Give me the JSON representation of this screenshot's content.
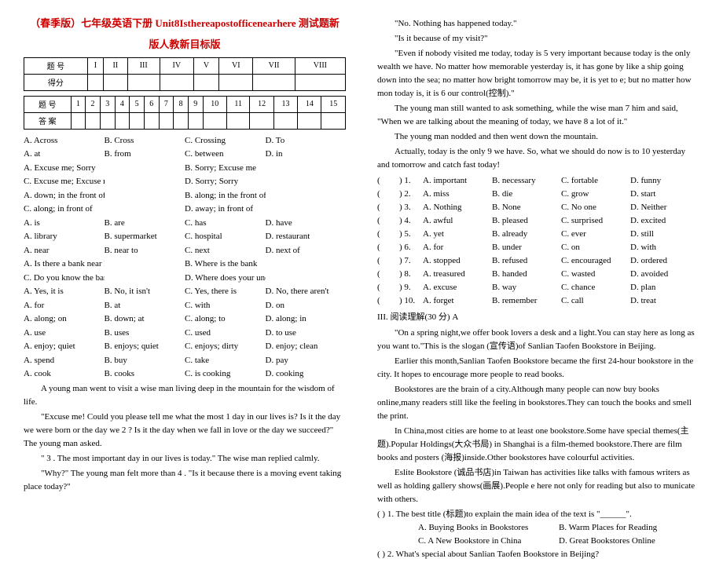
{
  "title_line1": "（春季版）七年级英语下册 Unit8Isthereapostofficenearhere 测试题新",
  "title_line2": "版人教新目标版",
  "table1": {
    "r1": [
      "题 号",
      "I",
      "II",
      "III",
      "IV",
      "V",
      "VI",
      "VII",
      "VIII"
    ],
    "r2": "得分"
  },
  "table2": {
    "r1": [
      "题 号",
      "1",
      "2",
      "3",
      "4",
      "5",
      "6",
      "7",
      "8",
      "9",
      "10",
      "11",
      "12",
      "13",
      "14",
      "15"
    ],
    "r2": "答 案"
  },
  "mc": [
    {
      "a": "A. Across",
      "b": "B. Cross",
      "c": "C. Crossing",
      "d": "D. To"
    },
    {
      "a": "A. at",
      "b": "B. from",
      "c": "C. between",
      "d": "D. in"
    },
    {
      "a": "A. Excuse me; Sorry",
      "b": "",
      "c": "B. Sorry; Excuse me",
      "d": ""
    },
    {
      "a": "C. Excuse me; Excuse me",
      "b": "",
      "c": "D. Sorry; Sorry",
      "d": ""
    },
    {
      "a": "A. down; in the front of",
      "b": "",
      "c": "B. along; in the front of",
      "d": ""
    },
    {
      "a": "C. along; in front of",
      "b": "",
      "c": "D. away; in front of",
      "d": ""
    },
    {
      "a": "A. is",
      "b": "B. are",
      "c": "C. has",
      "d": "D. have"
    },
    {
      "a": "A. library",
      "b": "B. supermarket",
      "c": "C. hospital",
      "d": "D. restaurant"
    },
    {
      "a": "A. near",
      "b": "B. near to",
      "c": "C. next",
      "d": "D. next of"
    },
    {
      "a": "A. Is there a bank near here",
      "b": "",
      "c": "B. Where is the bank",
      "d": ""
    },
    {
      "a": "C. Do you know the bank",
      "b": "",
      "c": "D. Where does your uncle work",
      "d": ""
    },
    {
      "a": "A. Yes, it is",
      "b": "B. No, it isn't",
      "c": "C. Yes, there is",
      "d": "D. No, there aren't"
    },
    {
      "a": "A. for",
      "b": "B. at",
      "c": "C. with",
      "d": "D. on"
    },
    {
      "a": "A. along; on",
      "b": "B. down; at",
      "c": "C. along; to",
      "d": "D. along; in"
    },
    {
      "a": "A. use",
      "b": "B. uses",
      "c": "C. used",
      "d": "D. to use"
    },
    {
      "a": "A. enjoy; quiet",
      "b": "B. enjoys; quiet",
      "c": "C. enjoys; dirty",
      "d": "D. enjoy; clean"
    },
    {
      "a": "A. spend",
      "b": "B. buy",
      "c": "C. take",
      "d": "D. pay"
    },
    {
      "a": "A. cook",
      "b": "B. cooks",
      "c": "C. is cooking",
      "d": "D. cooking"
    }
  ],
  "passage1": {
    "p1": "A young man went to visit a wise man living deep in the mountain for the wisdom of life.",
    "p2": "\"Excuse me! Could you please tell me what the most   1   day in our lives is? Is it the day we were born or the day we   2  ? Is it the day when we fall in love or the day we succeed?\" The young man asked.",
    "p3": "\"  3  . The most important day in our lives is today.\" The wise man replied calmly.",
    "p4": "\"Why?\" The young man felt more than   4  . \"Is it because there is a moving event taking place today?\""
  },
  "col2": {
    "p1": "\"No. Nothing has happened today.\"",
    "p2": "\"Is it because of my visit?\"",
    "p3": "\"Even if nobody visited me today, today is   5   very important because today is the only wealth we have. No matter how memorable yesterday is, it has gone by like a ship going down into the sea; no matter how bright tomorrow may be, it is yet to e; but no matter how mon today is, it is   6   our control(控制).\"",
    "p4": "The young man still wanted to ask something, while the wise man   7   him and said, \"When we are talking about the meaning of today, we have   8   a lot of it.\"",
    "p5": "The young man nodded and then went down the mountain.",
    "p6": "Actually, today is the only   9   we have.  So, what we should do now is to   10   yesterday and tomorrow and catch fast today!"
  },
  "cloze": [
    {
      "n": "1.",
      "a": "A. important",
      "b": "B. necessary",
      "c": "C. fortable",
      "d": "D. funny"
    },
    {
      "n": "2.",
      "a": "A. miss",
      "b": "B. die",
      "c": "C. grow",
      "d": "D. start"
    },
    {
      "n": "3.",
      "a": "A. Nothing",
      "b": "B. None",
      "c": "C. No one",
      "d": "D. Neither"
    },
    {
      "n": "4.",
      "a": "A. awful",
      "b": "B. pleased",
      "c": "C. surprised",
      "d": "D. excited"
    },
    {
      "n": "5.",
      "a": "A. yet",
      "b": "B. already",
      "c": "C. ever",
      "d": "D. still"
    },
    {
      "n": "6.",
      "a": "A. for",
      "b": "B. under",
      "c": "C. on",
      "d": "D. with"
    },
    {
      "n": "7.",
      "a": "A. stopped",
      "b": "B. refused",
      "c": "C. encouraged",
      "d": "D. ordered"
    },
    {
      "n": "8.",
      "a": "A. treasured",
      "b": "B. handed",
      "c": "C. wasted",
      "d": "D. avoided"
    },
    {
      "n": "9.",
      "a": "A. excuse",
      "b": "B. way",
      "c": "C. chance",
      "d": "D. plan"
    },
    {
      "n": "10.",
      "a": "A. forget",
      "b": "B. remember",
      "c": "C. call",
      "d": "D. treat"
    }
  ],
  "section3_head": "III. 阅读理解(30 分)                                       A",
  "reading": {
    "p1": "\"On a spring night,we offer book lovers a desk and a light.You can stay here as long as you want to.\"This is the slogan (宣传语)of Sanlian Taofen Bookstore in Beijing.",
    "p2": "Earlier this month,Sanlian Taofen Bookstore became the first 24-hour bookstore in the city. It hopes to encourage more people to read books.",
    "p3": "Bookstores are the brain of a city.Although many people can now buy books online,many readers still like the feeling in bookstores.They can touch the books and smell the print.",
    "p4": "In China,most cities are home to at least one bookstore.Some have special themes(主题).Popular Holdings(大众书局) in Shanghai is a film-themed bookstore.There are film books and posters (海报)inside.Other bookstores have colourful activities.",
    "p5": "Eslite Bookstore (诚品书店)in Taiwan has activities like talks with famous writers as well as holding gallery shows(画展).People e here not only for reading but also to municate with others."
  },
  "rq": {
    "q1": "(      ) 1. The best title (标题)to explain the main idea of the text is \"______\".",
    "q1a": "A. Buying Books in Bookstores",
    "q1b": "B. Warm Places for Reading",
    "q1c": "C. A New Bookstore in China",
    "q1d": "D. Great Bookstores Online",
    "q2": "(      ) 2. What's special about Sanlian Taofen Bookstore in Beijing?"
  }
}
